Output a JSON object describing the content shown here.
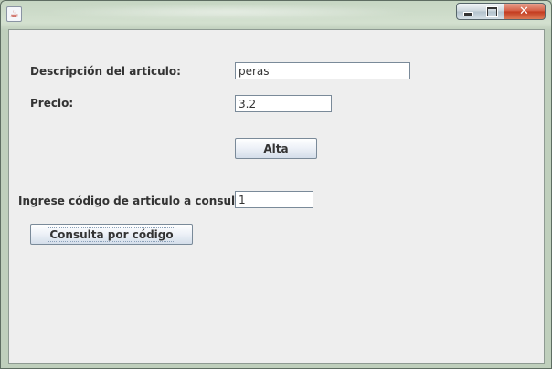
{
  "window": {
    "app_icon_glyph": "☕",
    "controls": {
      "minimize": "",
      "maximize": "",
      "close": "✕"
    }
  },
  "form": {
    "descripcion": {
      "label": "Descripción del articulo:",
      "value": "peras"
    },
    "precio": {
      "label": "Precio:",
      "value": "3.2"
    },
    "alta_button": "Alta",
    "consulta": {
      "label": "Ingrese código de articulo a consultar:",
      "value": "1"
    },
    "consulta_button": "Consulta por código"
  },
  "colors": {
    "panel_background": "#eeeeee",
    "close_button": "#c2391e",
    "title_bar": "#c6d6c3"
  }
}
